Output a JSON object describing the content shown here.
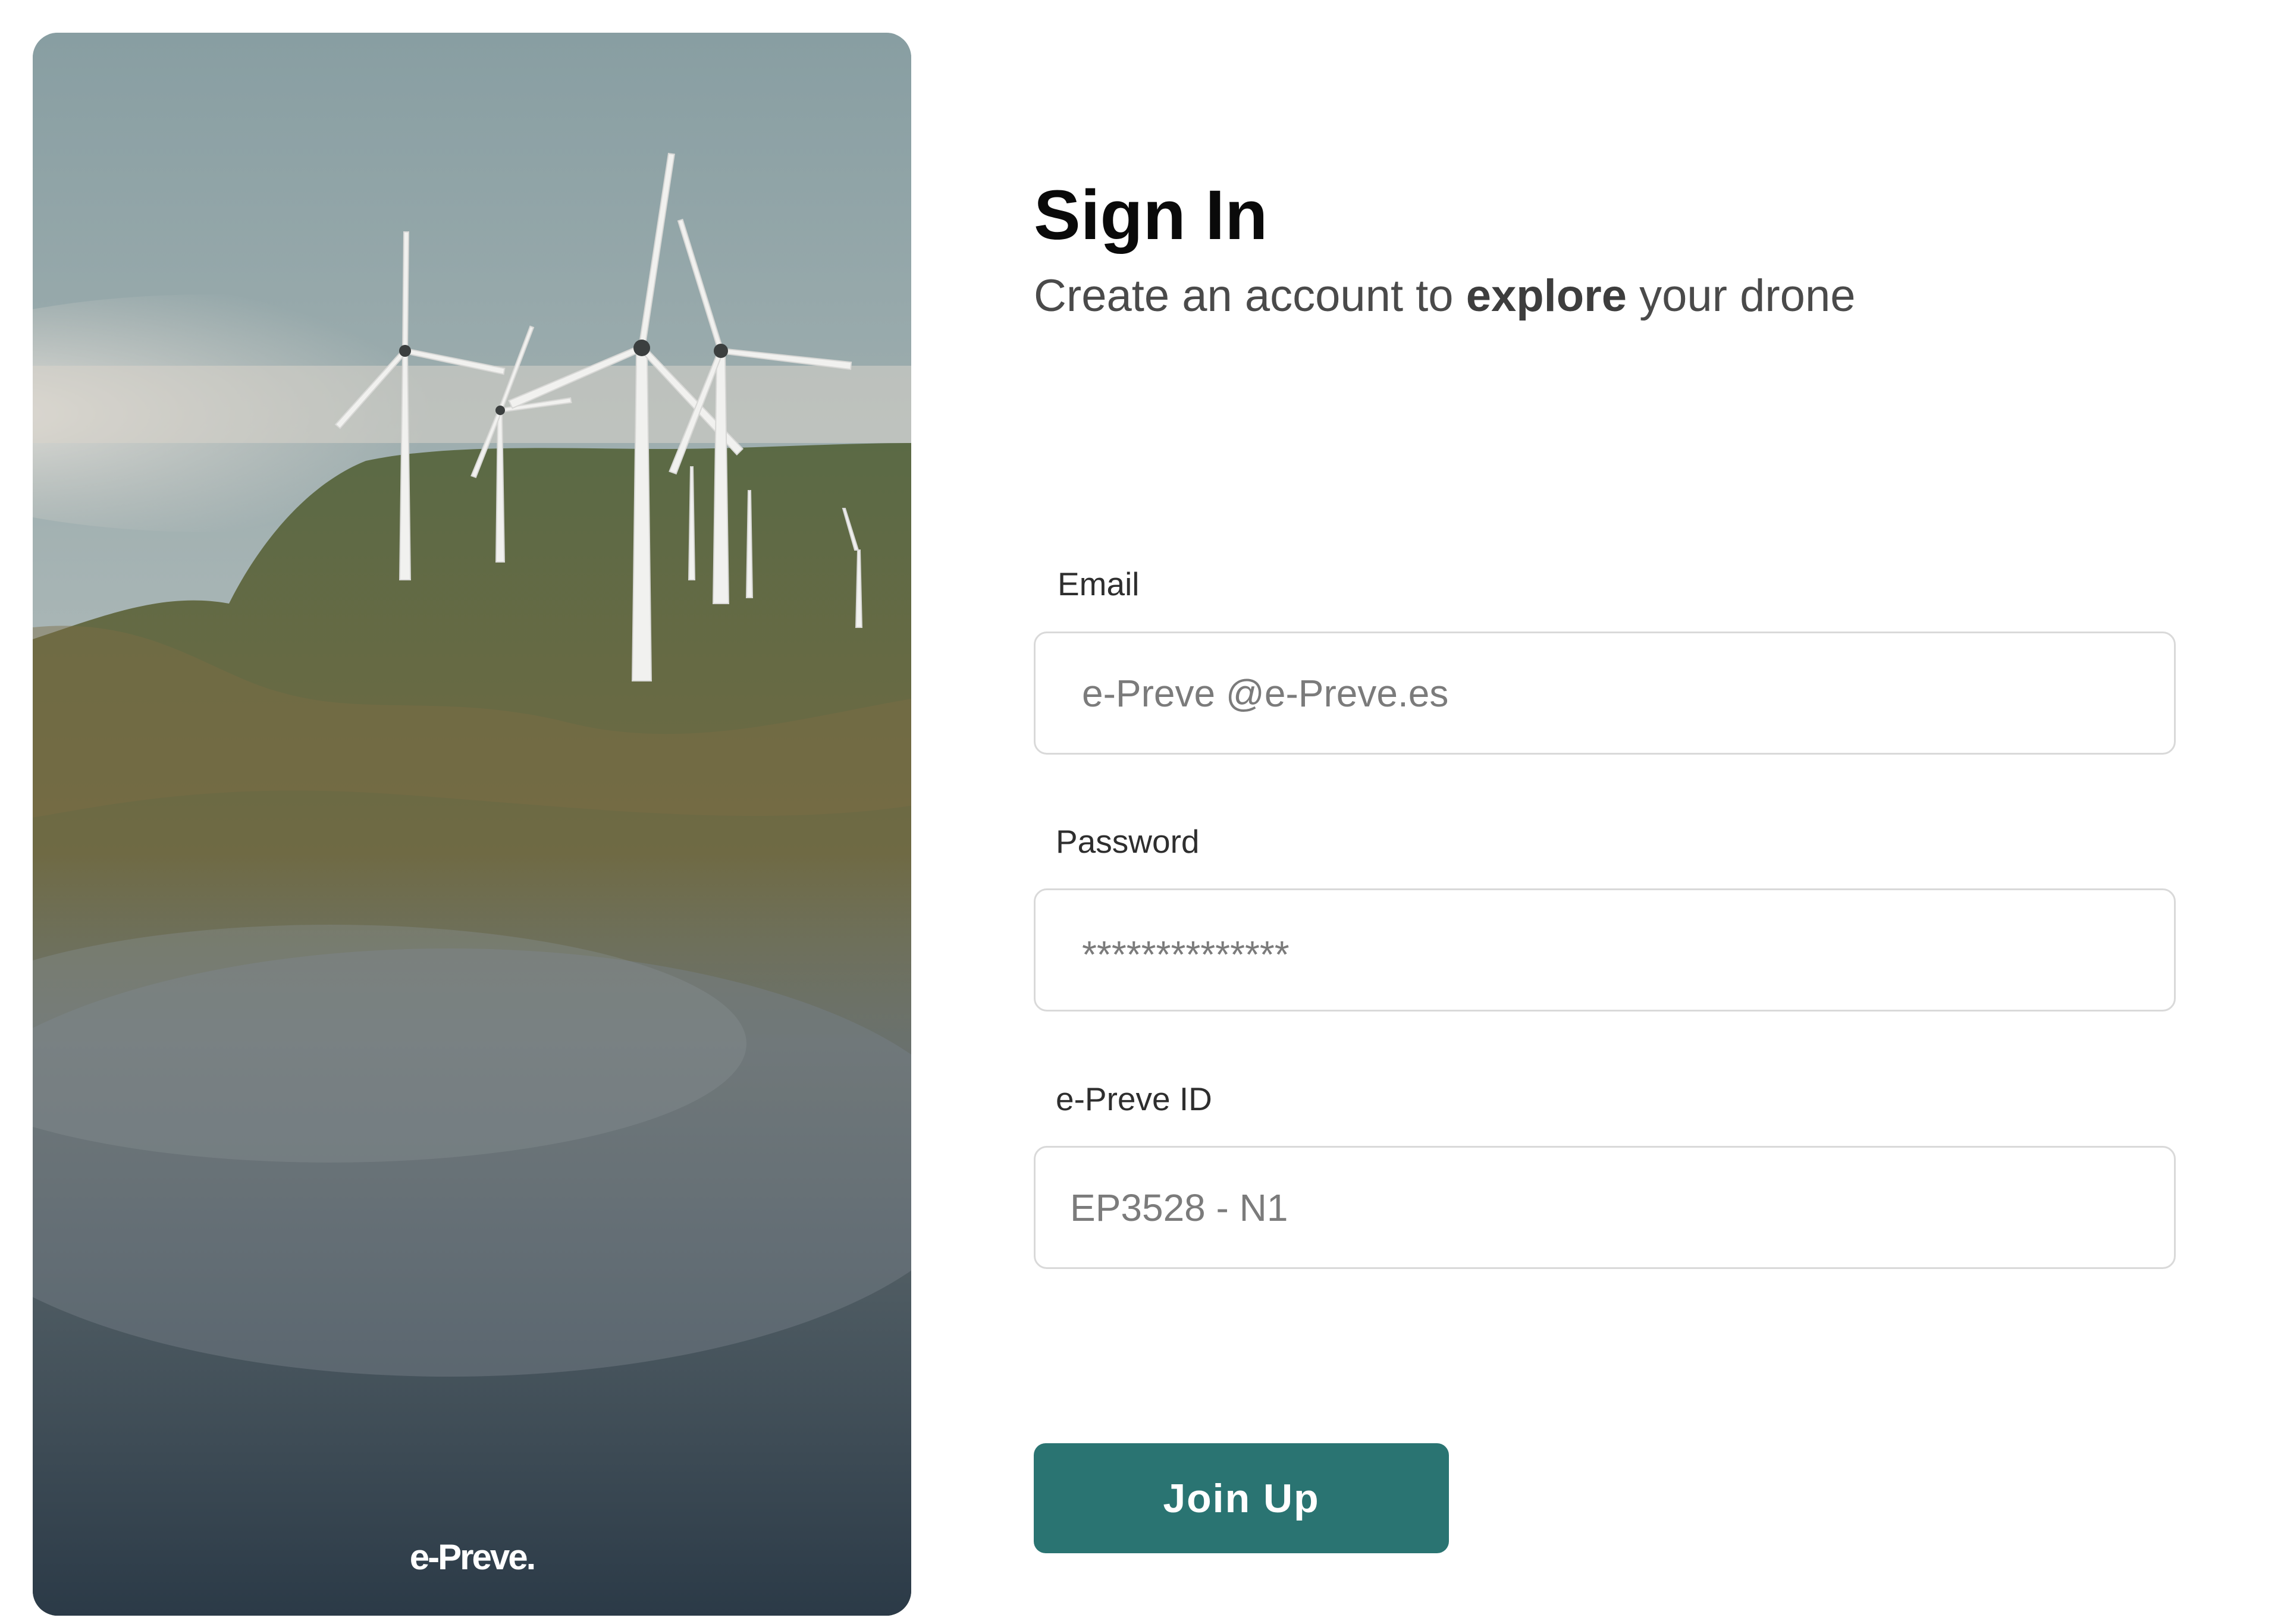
{
  "hero": {
    "logo_text": "e-Preve."
  },
  "header": {
    "title": "Sign In",
    "subtitle_before": "Create an account to ",
    "subtitle_emphasis": "explore",
    "subtitle_after": " your drone"
  },
  "form": {
    "email": {
      "label": "Email",
      "placeholder": "e-Preve @e-Preve.es"
    },
    "password": {
      "label": "Password",
      "placeholder": "**************"
    },
    "id": {
      "label": "e-Preve ID",
      "placeholder": "EP3528 - N1"
    },
    "submit_label": "Join Up"
  },
  "colors": {
    "accent": "#2a7472",
    "title": "#0a0a0a",
    "subtitle": "#4a4a4a",
    "field_border": "#d9d9d9",
    "placeholder": "#7b7b7b"
  }
}
